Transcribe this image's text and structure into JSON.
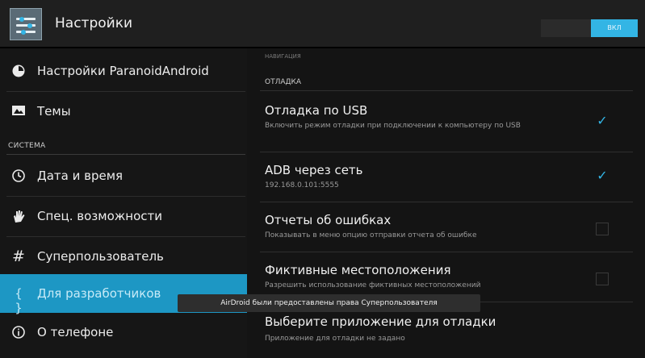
{
  "actionbar": {
    "title": "Настройки",
    "toggle_label": "ВКЛ",
    "accent": "#33b5e5"
  },
  "left_pane": {
    "items": [
      {
        "icon": "paranoid-icon",
        "label": "Настройки ParanoidAndroid"
      },
      {
        "icon": "themes-icon",
        "label": "Темы"
      }
    ],
    "section_system": "СИСТЕМА",
    "system_items": [
      {
        "icon": "clock-icon",
        "label": "Дата и время"
      },
      {
        "icon": "hand-icon",
        "label": "Спец. возможности"
      },
      {
        "icon": "hash-icon",
        "label": "Суперпользователь"
      },
      {
        "icon": "braces-icon",
        "label": "Для разработчиков",
        "selected": true
      },
      {
        "icon": "info-icon",
        "label": "О телефоне"
      }
    ]
  },
  "right_pane": {
    "partial_header": "НАВИГАЦИЯ",
    "section_debug": "ОТЛАДКА",
    "prefs": [
      {
        "title": "Отладка по USB",
        "summary": "Включить режим отладки при подключении к компьютеру по USB",
        "checked": true
      },
      {
        "title": "ADB через сеть",
        "summary": "192.168.0.101:5555",
        "checked": true
      },
      {
        "title": "Отчеты об ошибках",
        "summary": "Показывать в меню опцию отправки отчета об ошибке",
        "checked": false
      },
      {
        "title": "Фиктивные местоположения",
        "summary": "Разрешить использование фиктивных местоположений",
        "checked": false
      },
      {
        "title": "Выберите приложение для отладки",
        "summary": "Приложение для отладки не задано"
      }
    ]
  },
  "toast": {
    "text": "AirDroid были предоставлены права Суперпользователя"
  }
}
